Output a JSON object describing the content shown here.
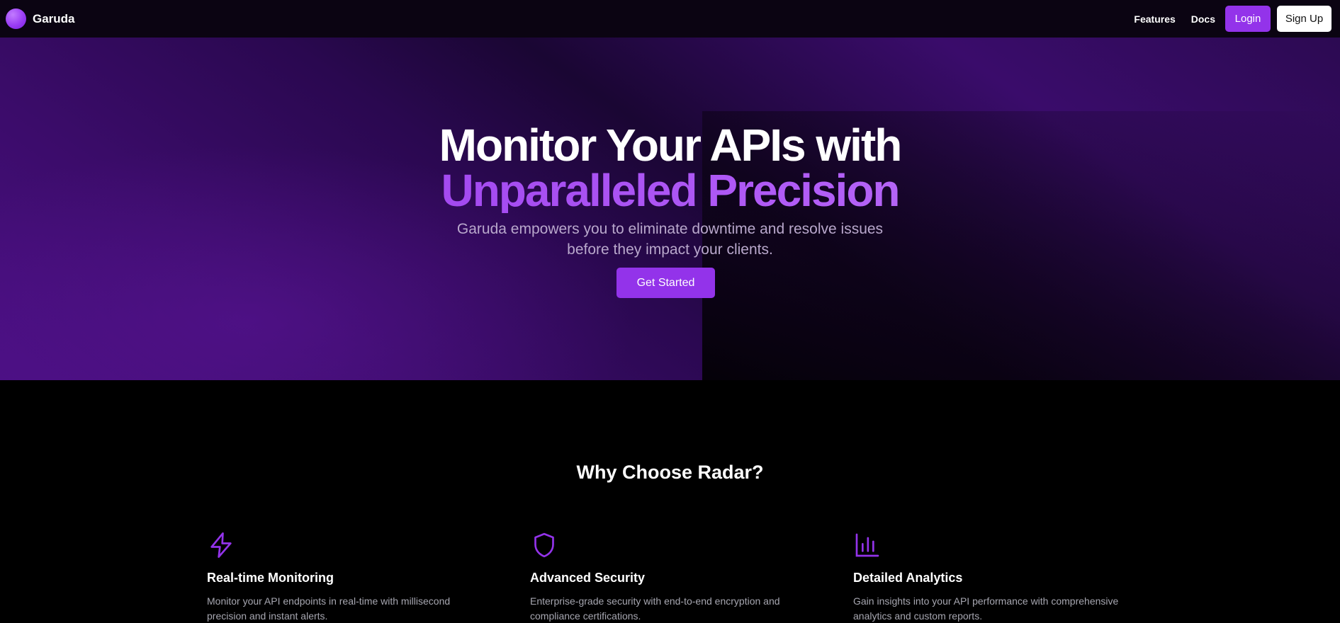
{
  "header": {
    "brand": "Garuda",
    "nav": {
      "features": "Features",
      "docs": "Docs"
    },
    "login": "Login",
    "signup": "Sign Up"
  },
  "hero": {
    "title_line1": "Monitor Your APIs with",
    "title_line2": "Unparalleled Precision",
    "description": "Garuda empowers you to eliminate downtime and resolve issues before they impact your clients.",
    "cta": "Get Started"
  },
  "features": {
    "heading": "Why Choose Radar?",
    "items": [
      {
        "icon": "lightning-icon",
        "title": "Real-time Monitoring",
        "description": "Monitor your API endpoints in real-time with millisecond precision and instant alerts."
      },
      {
        "icon": "shield-icon",
        "title": "Advanced Security",
        "description": "Enterprise-grade security with end-to-end encryption and compliance certifications."
      },
      {
        "icon": "bar-chart-icon",
        "title": "Detailed Analytics",
        "description": "Gain insights into your API performance with comprehensive analytics and custom reports."
      }
    ]
  },
  "colors": {
    "accent": "#9333ea",
    "background": "#000000",
    "hero_purple": "#3b0c6a"
  }
}
